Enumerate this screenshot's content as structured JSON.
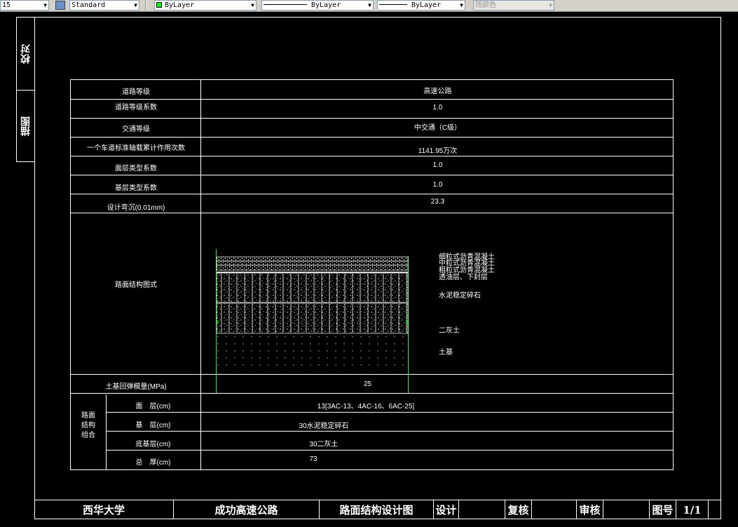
{
  "toolbar": {
    "dim_style_value": "15",
    "text_style_value": "Standard",
    "layer_color_value": "ByLayer",
    "linetype_value": "ByLayer",
    "lineweight_value": "ByLayer",
    "plotstyle_value": "随颜色",
    "colors": {
      "layer_swatch": "#00ff00"
    }
  },
  "side_tab": {
    "top_label": "校对",
    "bottom_label": "描图"
  },
  "table": {
    "rows": [
      {
        "label": "道路等级",
        "value": "高速公路"
      },
      {
        "label": "道路等级系数",
        "value": "1.0"
      },
      {
        "label": "交通等级",
        "value": "中交通（C级）"
      },
      {
        "label": "一个车道标准轴载累计作用次数",
        "value": "1141.95万次"
      },
      {
        "label": "面层类型系数",
        "value": "1.0"
      },
      {
        "label": "基层类型系数",
        "value": "1.0"
      },
      {
        "label": "设计弯沉(0.01mm)",
        "value": "23.3"
      }
    ],
    "diagram_label": "路面结构图式",
    "diagram_layers": [
      "细粒式沥青混凝土",
      "中粒式沥青混凝土",
      "粗粒式沥青混凝土",
      "透油层、下封层",
      "水泥稳定碎石",
      "二灰土",
      "土基"
    ],
    "modulus_label": "土基回弹模量(MPa)",
    "modulus_value": "25",
    "composition_label": "路面\n结构\n组合",
    "composition_rows": [
      {
        "label": "面　层(cm)",
        "value": "13[3AC-13、4AC-16、6AC-25]"
      },
      {
        "label": "基　层(cm)",
        "value": "30水泥稳定碎石"
      },
      {
        "label": "底基层(cm)",
        "value": "30二灰土"
      },
      {
        "label": "总　厚(cm)",
        "value": "73"
      }
    ]
  },
  "title_block": {
    "school": "西华大学",
    "project": "成功高速公路",
    "drawing": "路面结构设计图",
    "design_label": "设计",
    "design_value": "",
    "recheck_label": "复核",
    "recheck_value": "",
    "approve_label": "审核",
    "approve_value": "",
    "sheet_label": "图号",
    "sheet_value": "1/1"
  }
}
